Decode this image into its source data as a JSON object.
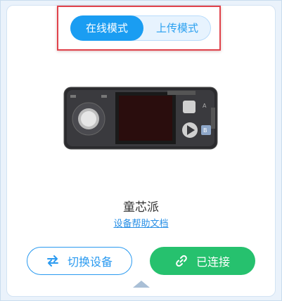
{
  "mode_switch": {
    "online_label": "在线模式",
    "upload_label": "上传模式",
    "active": "online"
  },
  "device": {
    "name": "童芯派",
    "help_link": "设备帮助文档"
  },
  "actions": {
    "switch_device_label": "切换设备",
    "connected_label": "已连接"
  },
  "colors": {
    "accent_blue": "#1a9df2",
    "connected_green": "#26c16e",
    "highlight_red": "#e0424b"
  },
  "icons": {
    "switch": "swap-arrows-icon",
    "connected": "link-icon",
    "collapse": "chevron-up-icon"
  }
}
